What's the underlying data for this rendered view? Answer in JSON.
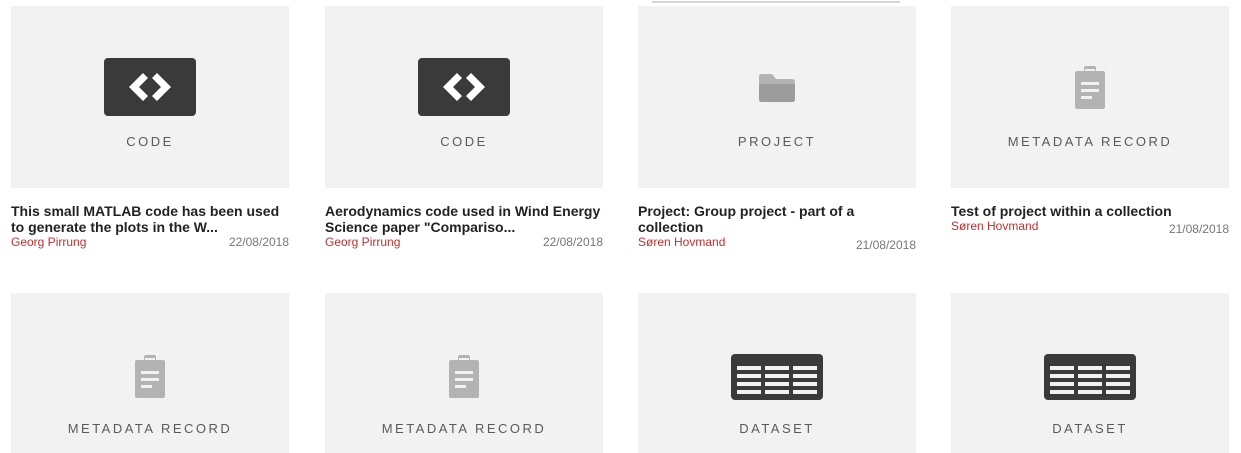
{
  "cards": [
    {
      "type": "CODE",
      "icon": "code-icon",
      "title": "This small MATLAB code has been used to generate the plots in the W...",
      "author": "Georg Pirrung",
      "date": "22/08/2018"
    },
    {
      "type": "CODE",
      "icon": "code-icon",
      "title": "Aerodynamics code used in Wind Energy Science paper \"Compariso...",
      "author": "Georg Pirrung",
      "date": "22/08/2018"
    },
    {
      "type": "PROJECT",
      "icon": "folder-icon",
      "title": "Project: Group project - part of a collection",
      "author": "Søren Hovmand",
      "date": "21/08/2018"
    },
    {
      "type": "METADATA RECORD",
      "icon": "clipboard-icon",
      "title": "Test of project within a collection",
      "author": "Søren Hovmand",
      "date": "21/08/2018"
    },
    {
      "type": "METADATA RECORD",
      "icon": "clipboard-icon"
    },
    {
      "type": "METADATA RECORD",
      "icon": "clipboard-icon"
    },
    {
      "type": "DATASET",
      "icon": "table-icon"
    },
    {
      "type": "DATASET",
      "icon": "table-icon"
    }
  ],
  "colors": {
    "author": "#c0312f",
    "icon_dark": "#3a3a3a",
    "icon_light": "#b0b0b0",
    "thumb_bg": "#f2f2f2"
  }
}
